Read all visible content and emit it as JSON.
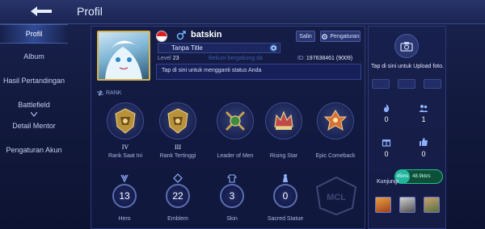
{
  "header": {
    "title": "Profil"
  },
  "sidebar": {
    "items": [
      {
        "label": "Profil"
      },
      {
        "label": "Album"
      },
      {
        "label": "Hasil Pertandingan"
      },
      {
        "label": "Battlefield"
      },
      {
        "label": "Detail Mentor"
      },
      {
        "label": "Pengaturan Akun"
      }
    ]
  },
  "profile": {
    "username": "batskin",
    "salin_label": "Salin",
    "pengaturan_label": "Pengaturan",
    "title_value": "Tanpa Title",
    "level_label": "Level",
    "level_value": "23",
    "joined_text": "Bekum bergabung da",
    "id_label": "ID:",
    "id_value": "197638461",
    "server_value": "(9009)",
    "status_placeholder": "Tap di sini untuk mengganti status Anda"
  },
  "rank": {
    "section_label": "RANK",
    "badges": [
      {
        "roman": "IV",
        "caption": "Rank Saat Ini"
      },
      {
        "roman": "III",
        "caption": "Rank Tertinggi"
      },
      {
        "roman": "",
        "caption": "Leader of Men"
      },
      {
        "roman": "",
        "caption": "Rising Star"
      },
      {
        "roman": "",
        "caption": "Epic Comeback"
      }
    ]
  },
  "stats": [
    {
      "value": "13",
      "caption": "Hero"
    },
    {
      "value": "22",
      "caption": "Emblem"
    },
    {
      "value": "3",
      "caption": "Skin"
    },
    {
      "value": "0",
      "caption": "Sacred Statue"
    }
  ],
  "right_panel": {
    "upload_text": "Tap di sini untuk Upload foto.",
    "counts": {
      "fire": "0",
      "friends": "1",
      "gift": "0",
      "likes": "0"
    },
    "visit_label": "Kunjungi",
    "net_ping": "45ms",
    "net_speed": "48.9kb/s"
  },
  "colors": {
    "accent": "#4a6ad0",
    "gold": "#d6b450",
    "net_green": "#26c08a"
  }
}
